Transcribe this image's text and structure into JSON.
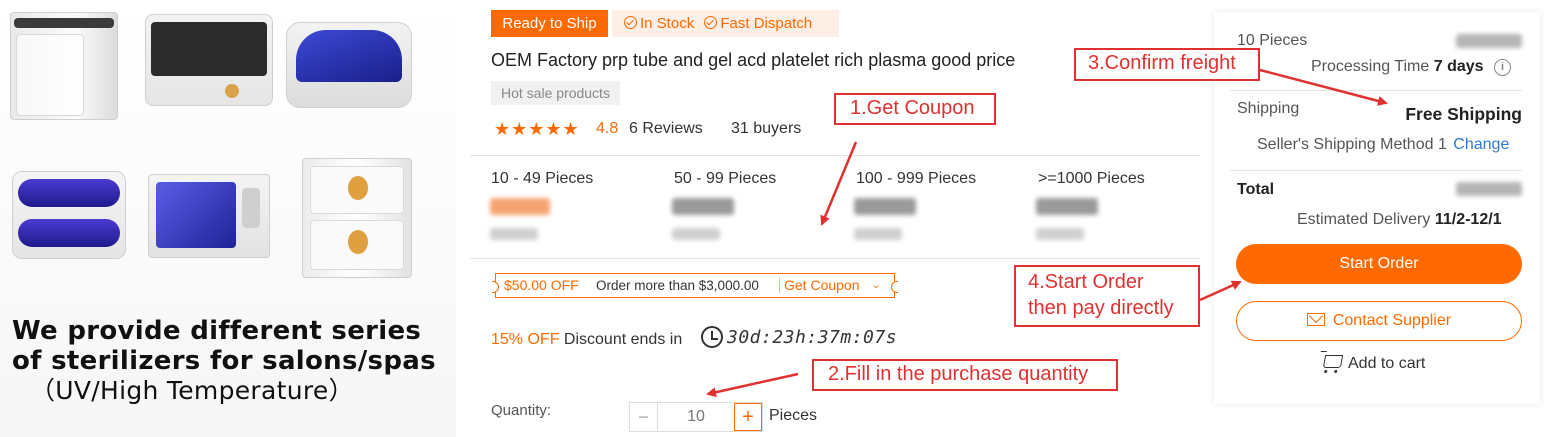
{
  "colors": {
    "accent": "#ff6a00",
    "callout": "#e03030"
  },
  "left_panel": {
    "caption": [
      "We provide different series",
      "of sterilizers for salons/spas",
      "（UV/High Temperature）"
    ]
  },
  "product": {
    "badge_ship": "Ready to Ship",
    "badge_stock": "In Stock",
    "badge_dispatch": "Fast Dispatch",
    "title": "OEM Factory prp tube and gel acd platelet rich plasma good price",
    "tag": "Hot sale products",
    "stars": "★★★★★",
    "rating": "4.8",
    "reviews": "6 Reviews",
    "buyers": "31 buyers",
    "tiers": [
      "10 - 49 Pieces",
      "50 - 99 Pieces",
      "100 - 999 Pieces",
      ">=1000 Pieces"
    ],
    "coupon": {
      "off": "$50.00 OFF",
      "condition": "Order more than $3,000.00",
      "get": "Get Coupon",
      "chevron": "⌄"
    },
    "discount": {
      "pct": "15% OFF",
      "text": "Discount ends in",
      "timer": "30d:23h:37m:07s"
    },
    "quantity": {
      "label": "Quantity:",
      "minus": "−",
      "value": "10",
      "plus": "+",
      "unit": "Pieces"
    }
  },
  "callouts": {
    "c1": "1.Get Coupon",
    "c2": "2.Fill in the purchase quantity",
    "c3": "3.Confirm freight",
    "c4_line1": "4.Start Order",
    "c4_line2": "then pay directly"
  },
  "order_panel": {
    "pieces": "10 Pieces",
    "processing_label": "Processing Time",
    "processing_value": "7 days",
    "info_icon": "i",
    "shipping_label": "Shipping",
    "shipping_value": "Free Shipping",
    "shipping_method": "Seller's Shipping Method 1",
    "change": "Change",
    "total_label": "Total",
    "delivery_label": "Estimated Delivery",
    "delivery_value": "11/2-12/1",
    "start_order": "Start Order",
    "contact_supplier": "Contact Supplier",
    "add_to_cart": "Add to cart"
  }
}
